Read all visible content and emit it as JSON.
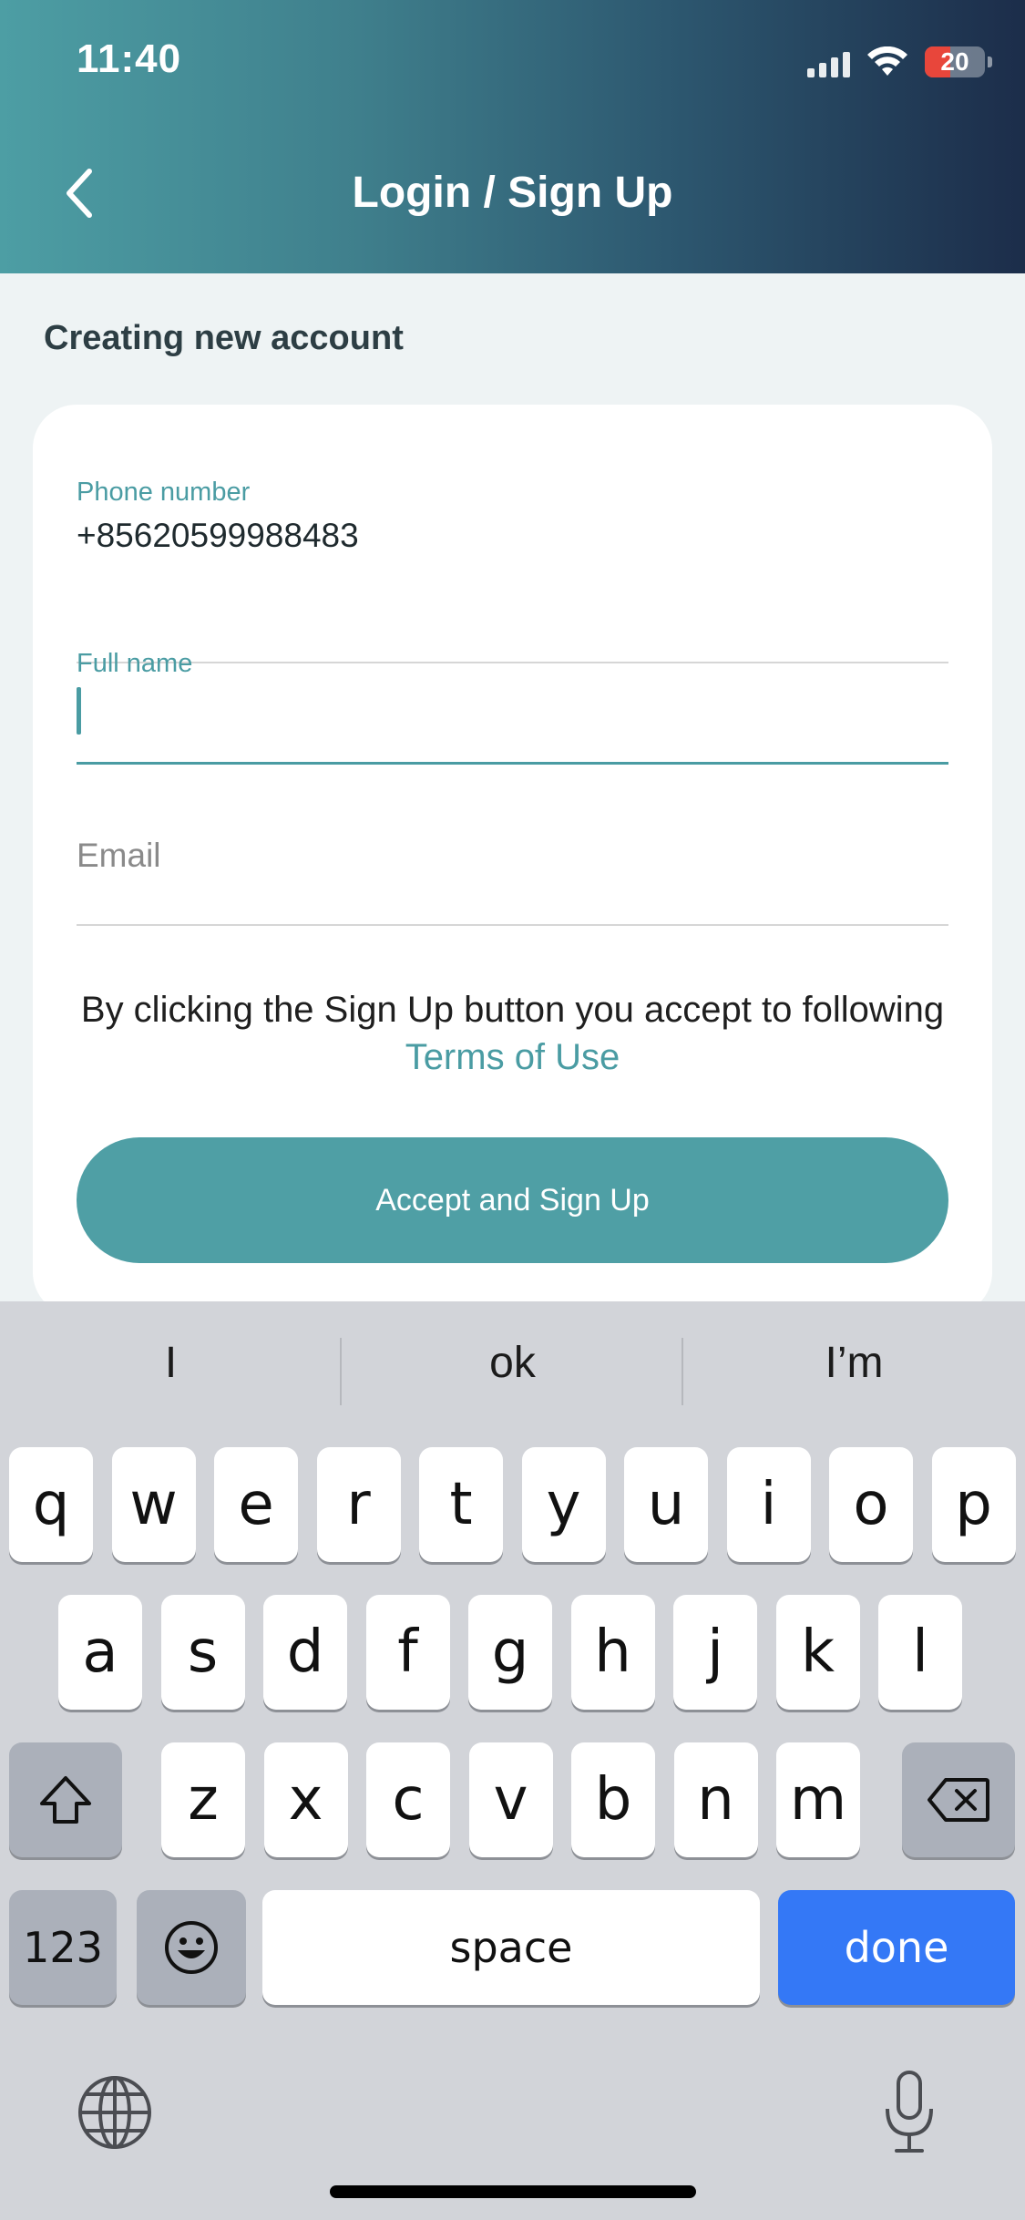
{
  "status_bar": {
    "time": "11:40",
    "battery": "20"
  },
  "header": {
    "title": "Login / Sign Up",
    "back_icon": "chevron-left-icon"
  },
  "section": {
    "label": "Creating new account"
  },
  "form": {
    "phone": {
      "label": "Phone number",
      "value": "+85620599988483"
    },
    "full_name": {
      "label": "Full name",
      "value": ""
    },
    "email": {
      "placeholder": "Email"
    },
    "terms": {
      "text": "By clicking the Sign Up button you accept to following",
      "link": "Terms of Use"
    },
    "submit_label": "Accept and Sign Up"
  },
  "keyboard": {
    "suggestions": [
      "I",
      "ok",
      "I’m"
    ],
    "row1": [
      "q",
      "w",
      "e",
      "r",
      "t",
      "y",
      "u",
      "i",
      "o",
      "p"
    ],
    "row2": [
      "a",
      "s",
      "d",
      "f",
      "g",
      "h",
      "j",
      "k",
      "l"
    ],
    "row3": [
      "z",
      "x",
      "c",
      "v",
      "b",
      "n",
      "m"
    ],
    "numbers_label": "123",
    "space_label": "space",
    "done_label": "done"
  },
  "colors": {
    "accent": "#4f9fa5",
    "done_key": "#3478f6",
    "header_start": "#4d9ea4",
    "header_end": "#1c2d4a"
  }
}
